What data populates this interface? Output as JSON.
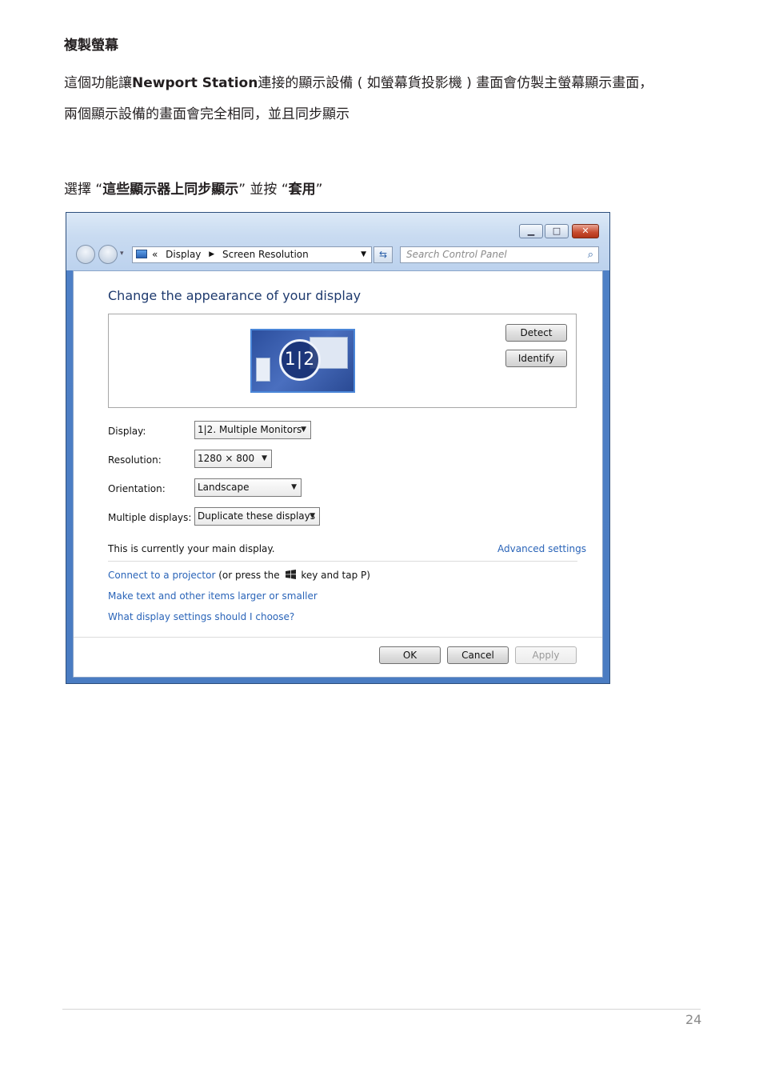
{
  "doc": {
    "heading": "複製螢幕",
    "para1_line1_pre": "這個功能讓",
    "para1_line1_bold": "Newport  Station",
    "para1_line1_post": "連接的顯示設備 ( 如螢幕貨投影機 ) 畫面會仿製主螢幕顯示畫面，",
    "para1_line2": "兩個顯示設備的畫面會完全相同，並且同步顯示",
    "instr_pre": "選擇 “",
    "instr_bold1": "這些顯示器上同步顯示",
    "instr_mid": "” 並按 “",
    "instr_bold2": "套用",
    "instr_post": "”",
    "page_number": "24"
  },
  "window": {
    "breadcrumb": {
      "sep": "«",
      "item1": "Display",
      "item2": "Screen Resolution"
    },
    "search_placeholder": "Search Control Panel",
    "pane_title": "Change the appearance of your display",
    "monitor_label": "1|2",
    "detect_label": "Detect",
    "identify_label": "Identify",
    "fields": {
      "display_label": "Display:",
      "display_value": "1|2. Multiple Monitors",
      "resolution_label": "Resolution:",
      "resolution_value": "1280 × 800",
      "orientation_label": "Orientation:",
      "orientation_value": "Landscape",
      "multiple_label": "Multiple displays:",
      "multiple_value": "Duplicate these displays"
    },
    "main_display_text": "This is currently your main display.",
    "advanced_link": "Advanced settings",
    "projector_link": "Connect to a projector",
    "projector_text_pre": "(or press the",
    "projector_text_post": "key and tap P)",
    "link_text_size": "Make text and other items larger or smaller",
    "link_which_settings": "What display settings should I choose?",
    "ok_label": "OK",
    "cancel_label": "Cancel",
    "apply_label": "Apply"
  }
}
